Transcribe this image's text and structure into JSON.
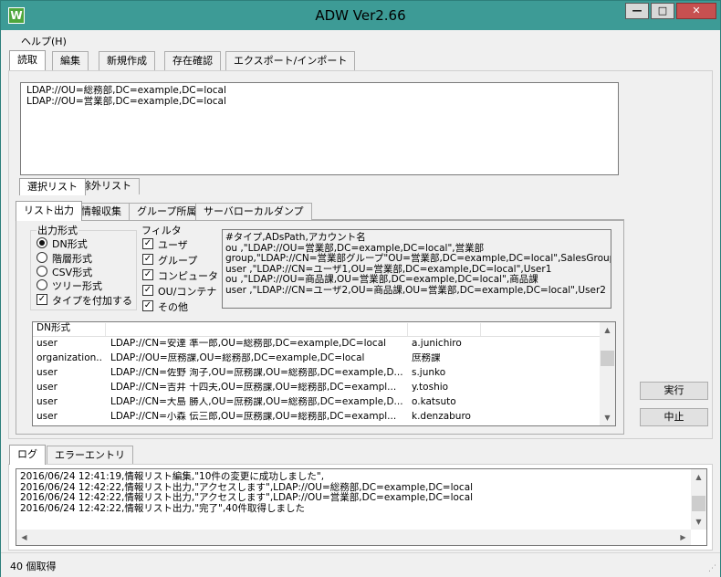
{
  "window": {
    "title": "ADW Ver2.66",
    "icon_letter": "W",
    "minimize": "—",
    "maximize": "□",
    "close": "✕"
  },
  "menu": {
    "help": "ヘルプ(H)"
  },
  "main_tabs": [
    "読取",
    "編集",
    "新規作成",
    "存在確認",
    "エクスポート/インポート"
  ],
  "dn_input": {
    "lines": [
      "LDAP://OU=総務部,DC=example,DC=local",
      "LDAP://OU=営業部,DC=example,DC=local"
    ]
  },
  "select_tabs": [
    "選択リスト",
    "除外リスト"
  ],
  "sub_tabs": [
    "リスト出力",
    "情報収集",
    "グループ所属",
    "サーバローカルダンプ"
  ],
  "output_format": {
    "title": "出力形式",
    "options": [
      "DN形式",
      "階層形式",
      "CSV形式",
      "ツリー形式"
    ],
    "selected": "DN形式",
    "add_type_label": "タイプを付加する",
    "add_type_checked": true
  },
  "filter": {
    "title": "フィルタ",
    "items": [
      {
        "label": "ユーザ",
        "checked": true
      },
      {
        "label": "グループ",
        "checked": true
      },
      {
        "label": "コンピュータ",
        "checked": true
      },
      {
        "label": "OU/コンテナ",
        "checked": true
      },
      {
        "label": "その他",
        "checked": true
      }
    ]
  },
  "sample_output": {
    "lines": [
      "#タイプ,ADsPath,アカウント名",
      "ou   ,\"LDAP://OU=営業部,DC=example,DC=local\",営業部",
      "group,\"LDAP://CN=営業部グループ\"OU=営業部,DC=example,DC=local\",SalesGroup",
      "user  ,\"LDAP://CN=ユーザ1,OU=営業部,DC=example,DC=local\",User1",
      "ou   ,\"LDAP://OU=商品課,OU=営業部,DC=example,DC=local\",商品課",
      "user  ,\"LDAP://CN=ユーザ2,OU=商品課,OU=営業部,DC=example,DC=local\",User2"
    ]
  },
  "result_list": {
    "headers": [
      "DN形式",
      "",
      ""
    ],
    "rows": [
      [
        "user",
        "LDAP://CN=安達 準一郎,OU=総務部,DC=example,DC=local",
        "a.junichiro"
      ],
      [
        "organization...",
        "LDAP://OU=庶務課,OU=総務部,DC=example,DC=local",
        "庶務課"
      ],
      [
        "user",
        "LDAP://CN=佐野 洵子,OU=庶務課,OU=総務部,DC=example,D...",
        "s.junko"
      ],
      [
        "user",
        "LDAP://CN=吉井 十四夫,OU=庶務課,OU=総務部,DC=exampl...",
        "y.toshio"
      ],
      [
        "user",
        "LDAP://CN=大島 勝人,OU=庶務課,OU=総務部,DC=example,D...",
        "o.katsuto"
      ],
      [
        "user",
        "LDAP://CN=小森 伝三郎,OU=庶務課,OU=総務部,DC=exampl...",
        "k.denzaburo"
      ]
    ]
  },
  "buttons": {
    "run": "実行",
    "stop": "中止"
  },
  "log_tabs": [
    "ログ",
    "エラーエントリ"
  ],
  "log": {
    "lines": [
      "2016/06/24 12:41:19,情報リスト編集,\"10件の変更に成功しました\",",
      "2016/06/24 12:42:22,情報リスト出力,\"アクセスします\",LDAP://OU=総務部,DC=example,DC=local",
      "2016/06/24 12:42:22,情報リスト出力,\"アクセスします\",LDAP://OU=営業部,DC=example,DC=local",
      "2016/06/24 12:42:22,情報リスト出力,\"完了\",40件取得しました"
    ]
  },
  "status": {
    "text": "40 個取得"
  }
}
